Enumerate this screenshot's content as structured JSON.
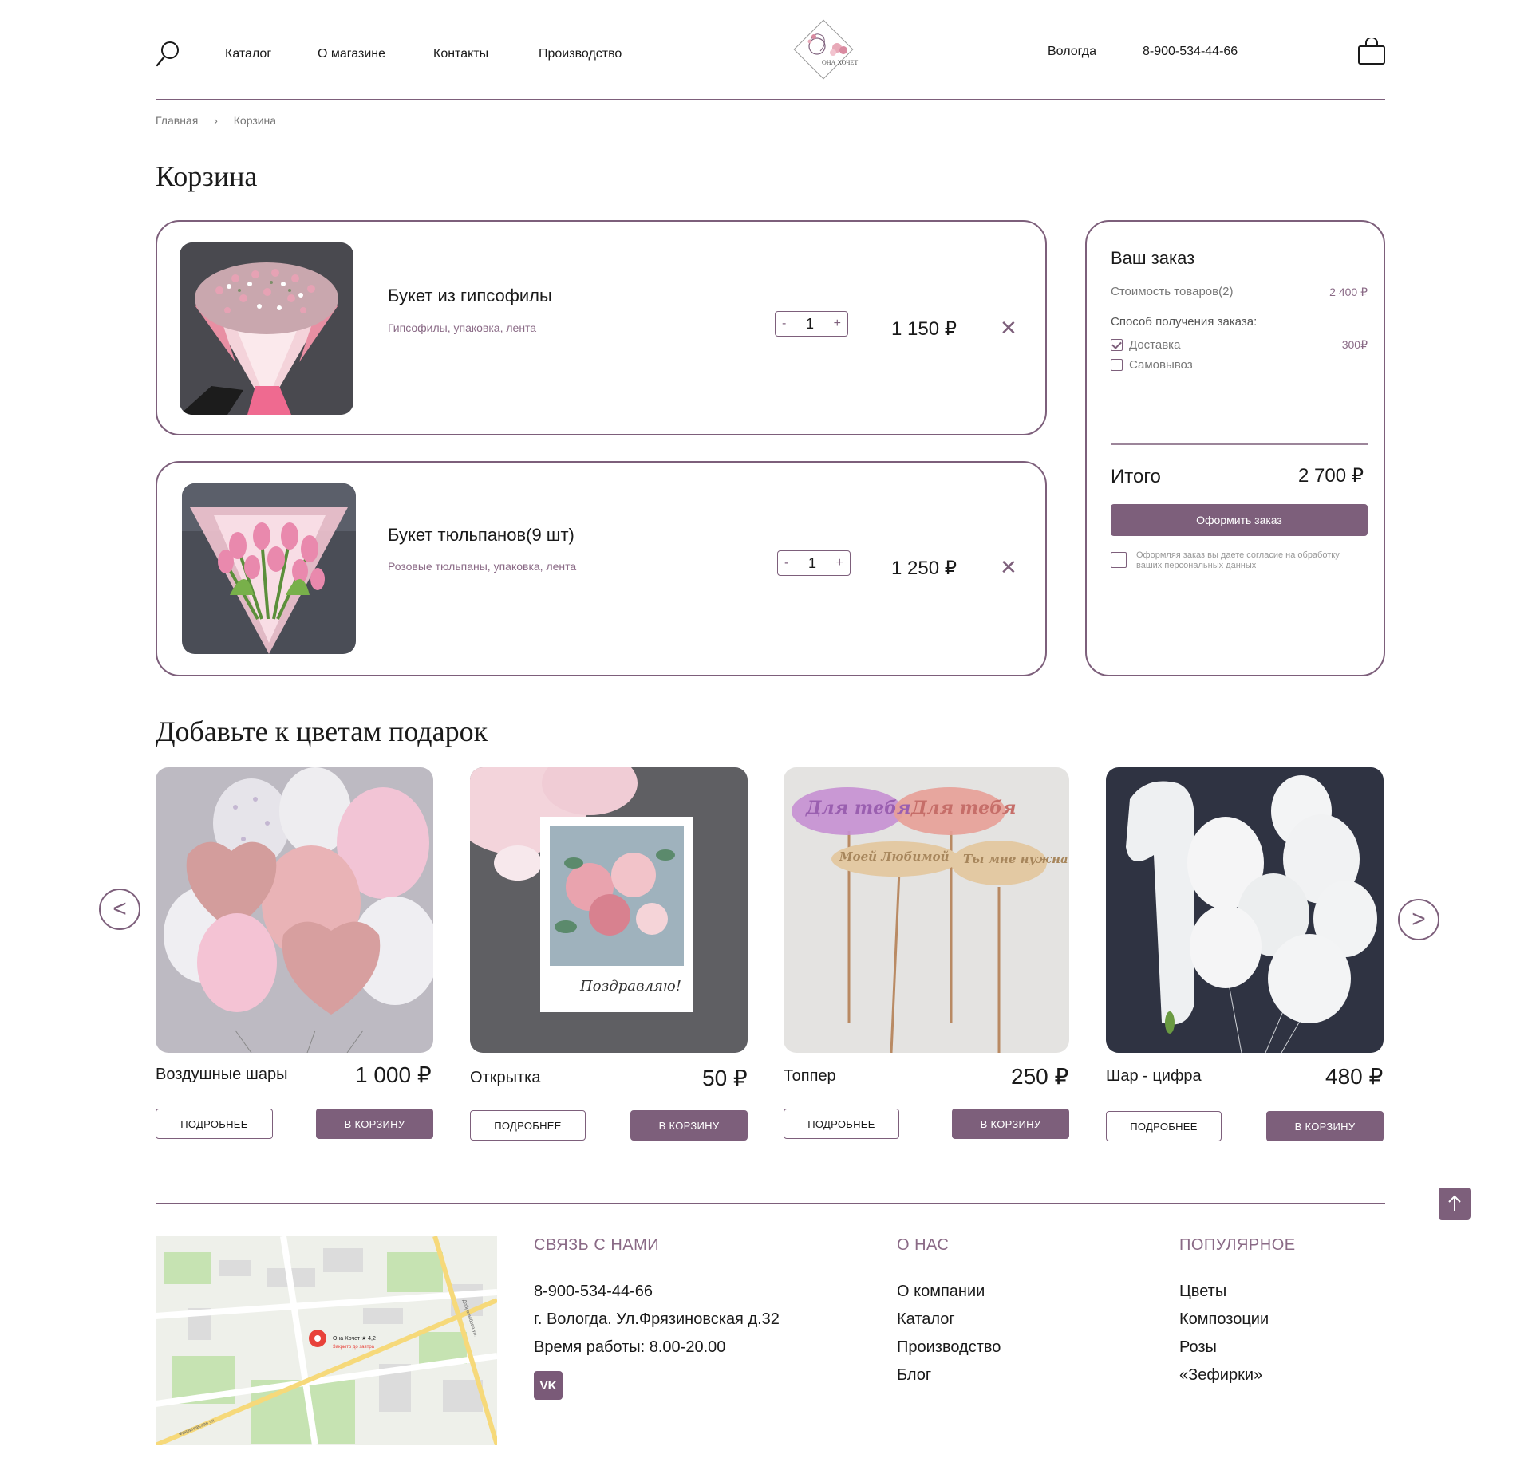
{
  "header": {
    "nav": [
      "Каталог",
      "О магазине",
      "Контакты",
      "Производство"
    ],
    "logo_text": "ОНА ХОЧЕТ",
    "city": "Вологда",
    "phone": "8-900-534-44-66"
  },
  "breadcrumb": [
    "Главная",
    "Корзина"
  ],
  "page_title": "Корзина",
  "cart": {
    "items": [
      {
        "name": "Букет из гипсофилы",
        "desc": "Гипсофилы, упаковка, лента",
        "qty": "1",
        "price": "1 150 ₽"
      },
      {
        "name": "Букет тюльпанов(9 шт)",
        "desc": "Розовые тюльпаны, упаковка, лента",
        "qty": "1",
        "price": "1 250 ₽"
      }
    ],
    "minus": "-",
    "plus": "+",
    "remove": "✕"
  },
  "summary": {
    "title": "Ваш заказ",
    "goods_label": "Стоимость товаров(2)",
    "goods_value": "2 400 ₽",
    "method_label": "Способ получения заказа:",
    "delivery_label": "Доставка",
    "delivery_value": "300₽",
    "delivery_checked": true,
    "pickup_label": "Самовывоз",
    "pickup_checked": false,
    "total_label": "Итого",
    "total_value": "2 700 ₽",
    "order_button": "Оформить заказ",
    "consent_line1": "Оформляя заказ вы даете согласие на обработку",
    "consent_line2": "ваших персональных данных"
  },
  "gifts": {
    "title": "Добавьте к цветам подарок",
    "items": [
      {
        "name": "Воздушные шары",
        "price": "1 000 ₽"
      },
      {
        "name": "Открытка",
        "price": "50 ₽"
      },
      {
        "name": "Топпер",
        "price": "250 ₽"
      },
      {
        "name": "Шар - цифра",
        "price": "480 ₽"
      }
    ],
    "more_label": "ПОДРОБНЕЕ",
    "cart_label": "В КОРЗИНУ",
    "prev": "<",
    "next": ">",
    "card_text": "Поздравляю!",
    "topper_text": [
      "Для тебя",
      "Для тебя",
      "Моей Любимой",
      "Ты мне нужна"
    ]
  },
  "footer": {
    "contact_title": "СВЯЗЬ С НАМИ",
    "contact_lines": [
      "8-900-534-44-66",
      "г. Вологда. Ул.Фрязиновская д.32",
      "Время работы: 8.00-20.00"
    ],
    "about_title": "О НАС",
    "about_links": [
      "О компании",
      "Каталог",
      "Производство",
      "Блог"
    ],
    "popular_title": "ПОПУЛЯРНОЕ",
    "popular_links": [
      "Цветы",
      "Композоции",
      "Розы",
      "«Зефирки»"
    ],
    "vk": "VK",
    "map_label": "Она Хочет ★ 4,2",
    "map_sublabel": "Закрыто до завтра",
    "map_streets": [
      "Фрязиновская ул.",
      "Добролюбова ул."
    ]
  },
  "colors": {
    "accent": "#7d5f7b",
    "text": "#1a1a1a"
  }
}
